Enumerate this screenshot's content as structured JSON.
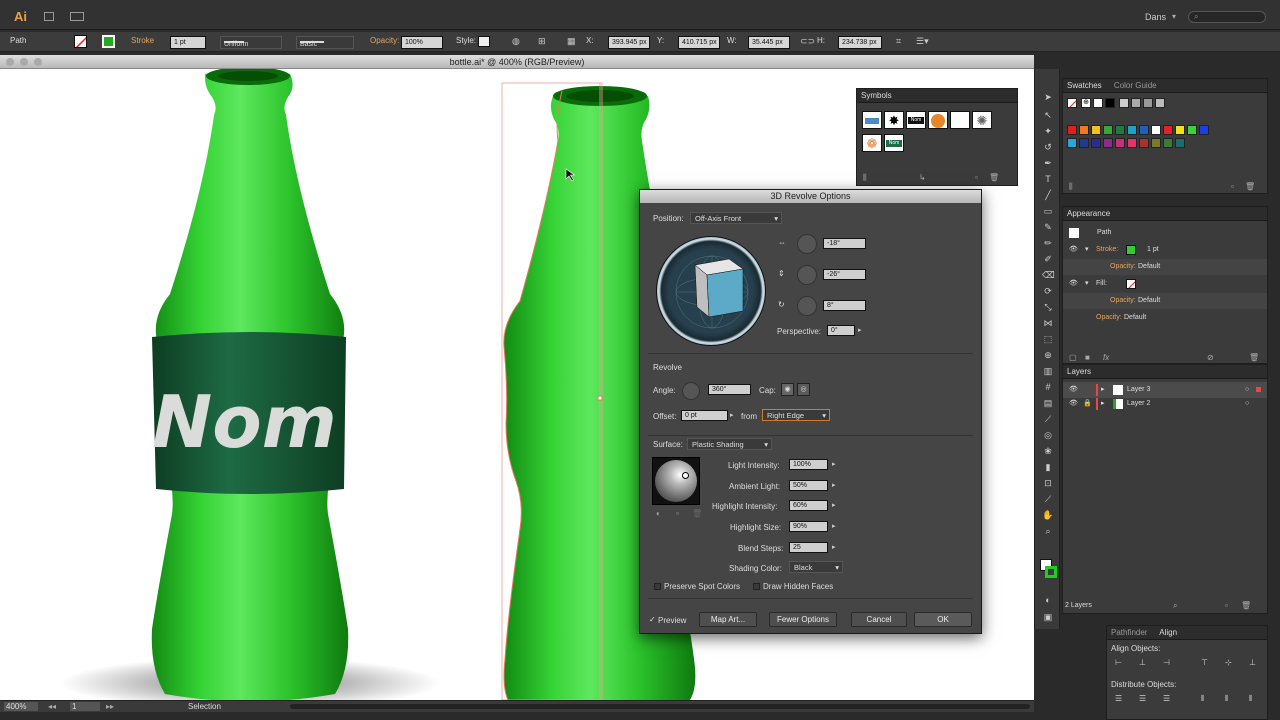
{
  "menubar": {
    "app_logo": "Ai",
    "user": "Dans"
  },
  "control": {
    "object_type": "Path",
    "stroke_label": "Stroke",
    "stroke_weight": "1 pt",
    "profile": "Uniform",
    "brush": "Basic",
    "opacity_label": "Opacity:",
    "opacity": "100%",
    "style_label": "Style:",
    "x_label": "X:",
    "x": "393.945 px",
    "y_label": "Y:",
    "y": "410.715 px",
    "w_label": "W:",
    "w": "35.445 px",
    "h_label": "H:",
    "h": "234.738 px"
  },
  "document": {
    "title": "bottle.ai* @ 400% (RGB/Preview)"
  },
  "canvas": {
    "label_text": "Nom"
  },
  "statusbar": {
    "zoom": "400%",
    "artboard": "1",
    "tool": "Selection"
  },
  "symbols": {
    "title": "Symbols",
    "label_a": "Nom",
    "label_b": "Nom"
  },
  "swatches": {
    "tabs": [
      "Swatches",
      "Color Guide"
    ],
    "colors_row1": [
      "#e31d1d",
      "#f07a1e",
      "#f3c11c",
      "#3aa53a",
      "#1f7a3e",
      "#1ca5c9",
      "#1f5fb8",
      "#ffffff",
      "#e61f2e",
      "#f2e318",
      "#3bd23b",
      "#1e3fe0"
    ],
    "colors_row2": [
      "#2aa7d6",
      "#1e3b8c",
      "#2c2c8a",
      "#8a2c8a",
      "#c9307a",
      "#e8306a",
      "#a83131",
      "#7a7a2c",
      "#3c7a3c",
      "#1e6b6b"
    ]
  },
  "appearance": {
    "title": "Appearance",
    "object": "Path",
    "stroke_label": "Stroke:",
    "stroke_value": "1 pt",
    "opacity_label": "Opacity:",
    "opacity_value": "Default",
    "fill_label": "Fill:",
    "fill_opacity_label": "Opacity:",
    "fill_opacity_value": "Default",
    "obj_opacity_label": "Opacity:",
    "obj_opacity_value": "Default"
  },
  "layers": {
    "title": "Layers",
    "items": [
      "Layer 3",
      "Layer 2"
    ],
    "count": "2 Layers"
  },
  "align": {
    "tabs": [
      "Pathfinder",
      "Align"
    ],
    "align_objects": "Align Objects:",
    "distribute_objects": "Distribute Objects:"
  },
  "dialog": {
    "title": "3D Revolve Options",
    "position_label": "Position:",
    "position_value": "Off-Axis Front",
    "angle_x": "-18°",
    "angle_y": "-26°",
    "angle_z": "8°",
    "perspective_label": "Perspective:",
    "perspective_value": "0°",
    "revolve_heading": "Revolve",
    "angle_label": "Angle:",
    "angle_value": "360°",
    "cap_label": "Cap:",
    "offset_label": "Offset:",
    "offset_value": "0 pt",
    "from_label": "from",
    "from_value": "Right Edge",
    "surface_label": "Surface:",
    "surface_value": "Plastic Shading",
    "light_intensity_label": "Light Intensity:",
    "light_intensity": "100%",
    "ambient_light_label": "Ambient Light:",
    "ambient_light": "50%",
    "highlight_intensity_label": "Highlight Intensity:",
    "highlight_intensity": "60%",
    "highlight_size_label": "Highlight Size:",
    "highlight_size": "90%",
    "blend_steps_label": "Blend Steps:",
    "blend_steps": "25",
    "shading_color_label": "Shading Color:",
    "shading_color": "Black",
    "preserve_spot": "Preserve Spot Colors",
    "draw_hidden": "Draw Hidden Faces",
    "preview": "Preview",
    "map_art": "Map Art...",
    "fewer_options": "Fewer Options",
    "cancel": "Cancel",
    "ok": "OK"
  }
}
